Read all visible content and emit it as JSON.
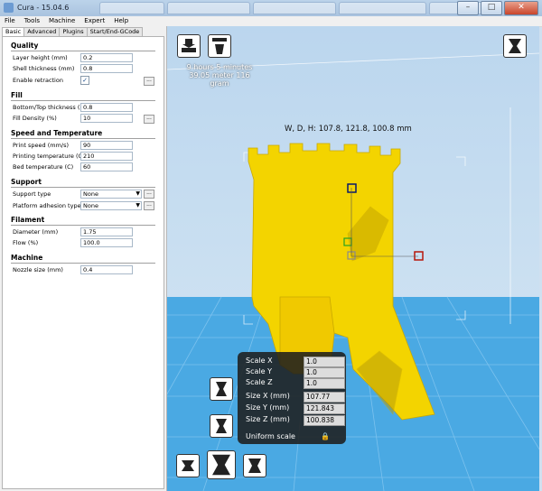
{
  "window": {
    "title": "Cura - 15.04.6",
    "close_glyph": "✕",
    "min_glyph": "–",
    "max_glyph": "□"
  },
  "menu": [
    "File",
    "Tools",
    "Machine",
    "Expert",
    "Help"
  ],
  "tabs": [
    "Basic",
    "Advanced",
    "Plugins",
    "Start/End-GCode"
  ],
  "settings": {
    "quality": {
      "title": "Quality",
      "layer_height": {
        "label": "Layer height (mm)",
        "value": "0.2"
      },
      "shell_thickness": {
        "label": "Shell thickness (mm)",
        "value": "0.8"
      },
      "retraction": {
        "label": "Enable retraction",
        "checked_glyph": "✓"
      }
    },
    "fill": {
      "title": "Fill",
      "bottom_top": {
        "label": "Bottom/Top thickness (mm)",
        "value": "0.8"
      },
      "density": {
        "label": "Fill Density (%)",
        "value": "10"
      }
    },
    "speed": {
      "title": "Speed and Temperature",
      "print_speed": {
        "label": "Print speed (mm/s)",
        "value": "90"
      },
      "print_temp": {
        "label": "Printing temperature (C)",
        "value": "210"
      },
      "bed_temp": {
        "label": "Bed temperature (C)",
        "value": "60"
      }
    },
    "support": {
      "title": "Support",
      "support_type": {
        "label": "Support type",
        "value": "None"
      },
      "adhesion": {
        "label": "Platform adhesion type",
        "value": "None"
      }
    },
    "filament": {
      "title": "Filament",
      "diameter": {
        "label": "Diameter (mm)",
        "value": "1.75"
      },
      "flow": {
        "label": "Flow (%)",
        "value": "100.0"
      }
    },
    "machine": {
      "title": "Machine",
      "nozzle": {
        "label": "Nozzle size (mm)",
        "value": "0.4"
      }
    },
    "more_button": "..."
  },
  "viewport": {
    "print_time": "9 hours 5 minutes",
    "print_material": "39.05 meter 116 gram",
    "dimensions": "W, D, H: 107.8, 121.8, 100.8 mm",
    "model_color": "#f3d400",
    "platform_color": "#4aa9e3"
  },
  "scale_panel": {
    "scale_x_label": "Scale X",
    "scale_x": "1.0",
    "scale_y_label": "Scale Y",
    "scale_y": "1.0",
    "scale_z_label": "Scale Z",
    "scale_z": "1.0",
    "size_x_label": "Size X (mm)",
    "size_x": "107.77",
    "size_y_label": "Size Y (mm)",
    "size_y": "121.843",
    "size_z_label": "Size Z (mm)",
    "size_z": "100.838",
    "uniform_label": "Uniform scale",
    "lock_glyph": "🔒"
  }
}
